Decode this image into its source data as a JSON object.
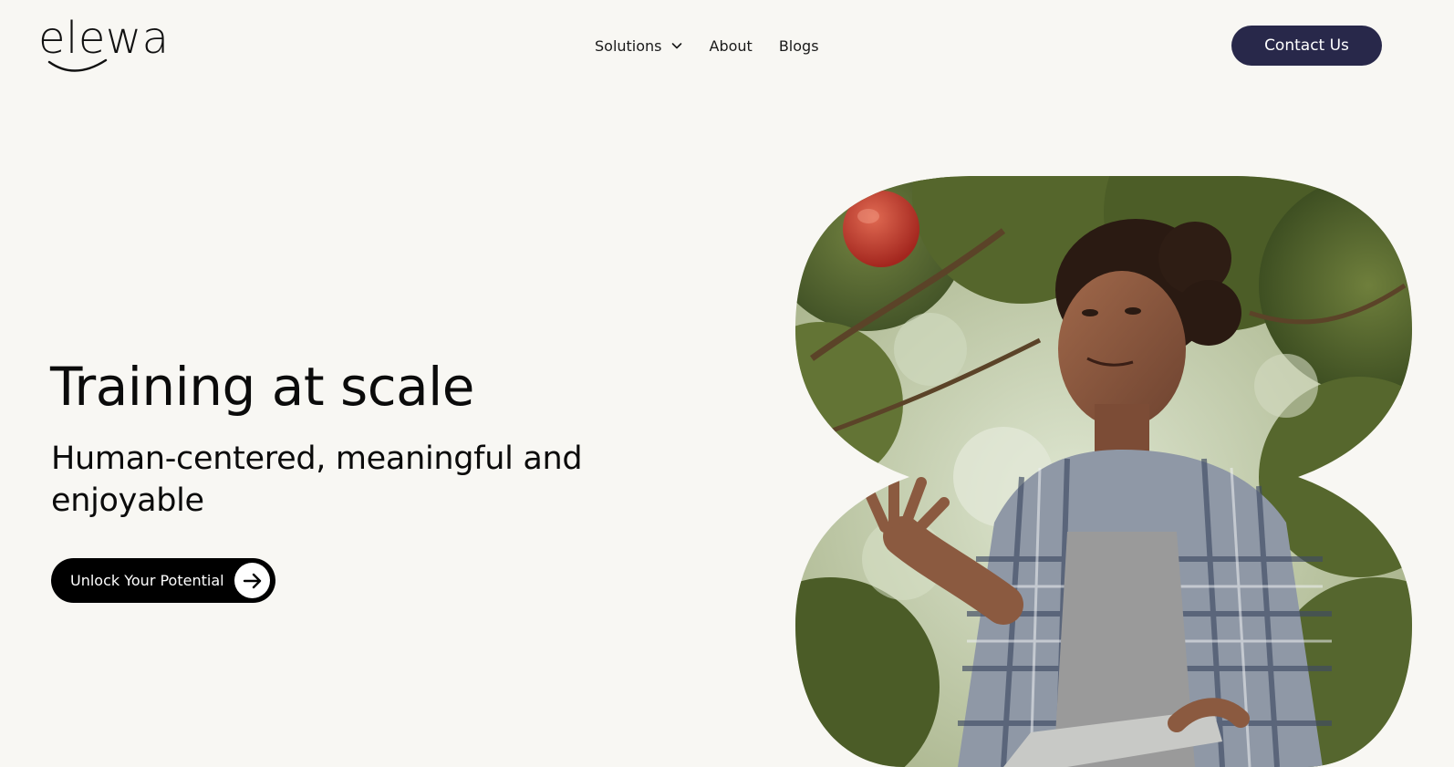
{
  "brand": {
    "name": "elewa",
    "accent": "#28284a"
  },
  "nav": {
    "items": [
      {
        "label": "Solutions",
        "icon": "chevron-down-icon"
      },
      {
        "label": "About"
      },
      {
        "label": "Blogs"
      }
    ],
    "contact_label": "Contact Us"
  },
  "hero": {
    "title": "Training at scale",
    "subtitle": "Human-centered, meaningful and enjoyable",
    "cta_label": "Unlock Your Potential",
    "cta_icon": "arrow-right-icon"
  }
}
